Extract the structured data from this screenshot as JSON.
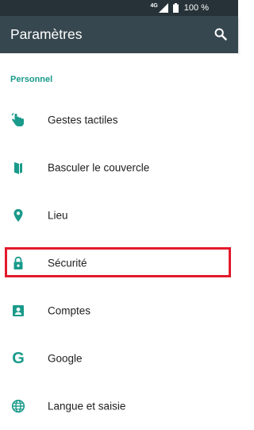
{
  "status_bar": {
    "network": "4G",
    "battery": "100 %"
  },
  "app_bar": {
    "title": "Paramètres"
  },
  "section": {
    "title": "Personnel"
  },
  "items": [
    {
      "label": "Gestes tactiles",
      "icon": "touch-gesture-icon"
    },
    {
      "label": "Basculer le couvercle",
      "icon": "flip-cover-icon"
    },
    {
      "label": "Lieu",
      "icon": "location-pin-icon"
    },
    {
      "label": "Sécurité",
      "icon": "lock-icon"
    },
    {
      "label": "Comptes",
      "icon": "account-icon"
    },
    {
      "label": "Google",
      "icon": "google-icon"
    },
    {
      "label": "Langue et saisie",
      "icon": "globe-icon"
    }
  ],
  "colors": {
    "accent": "#1a9a8a",
    "app_bar": "#37474f",
    "status_bar": "#263238",
    "highlight": "#e3192c"
  }
}
